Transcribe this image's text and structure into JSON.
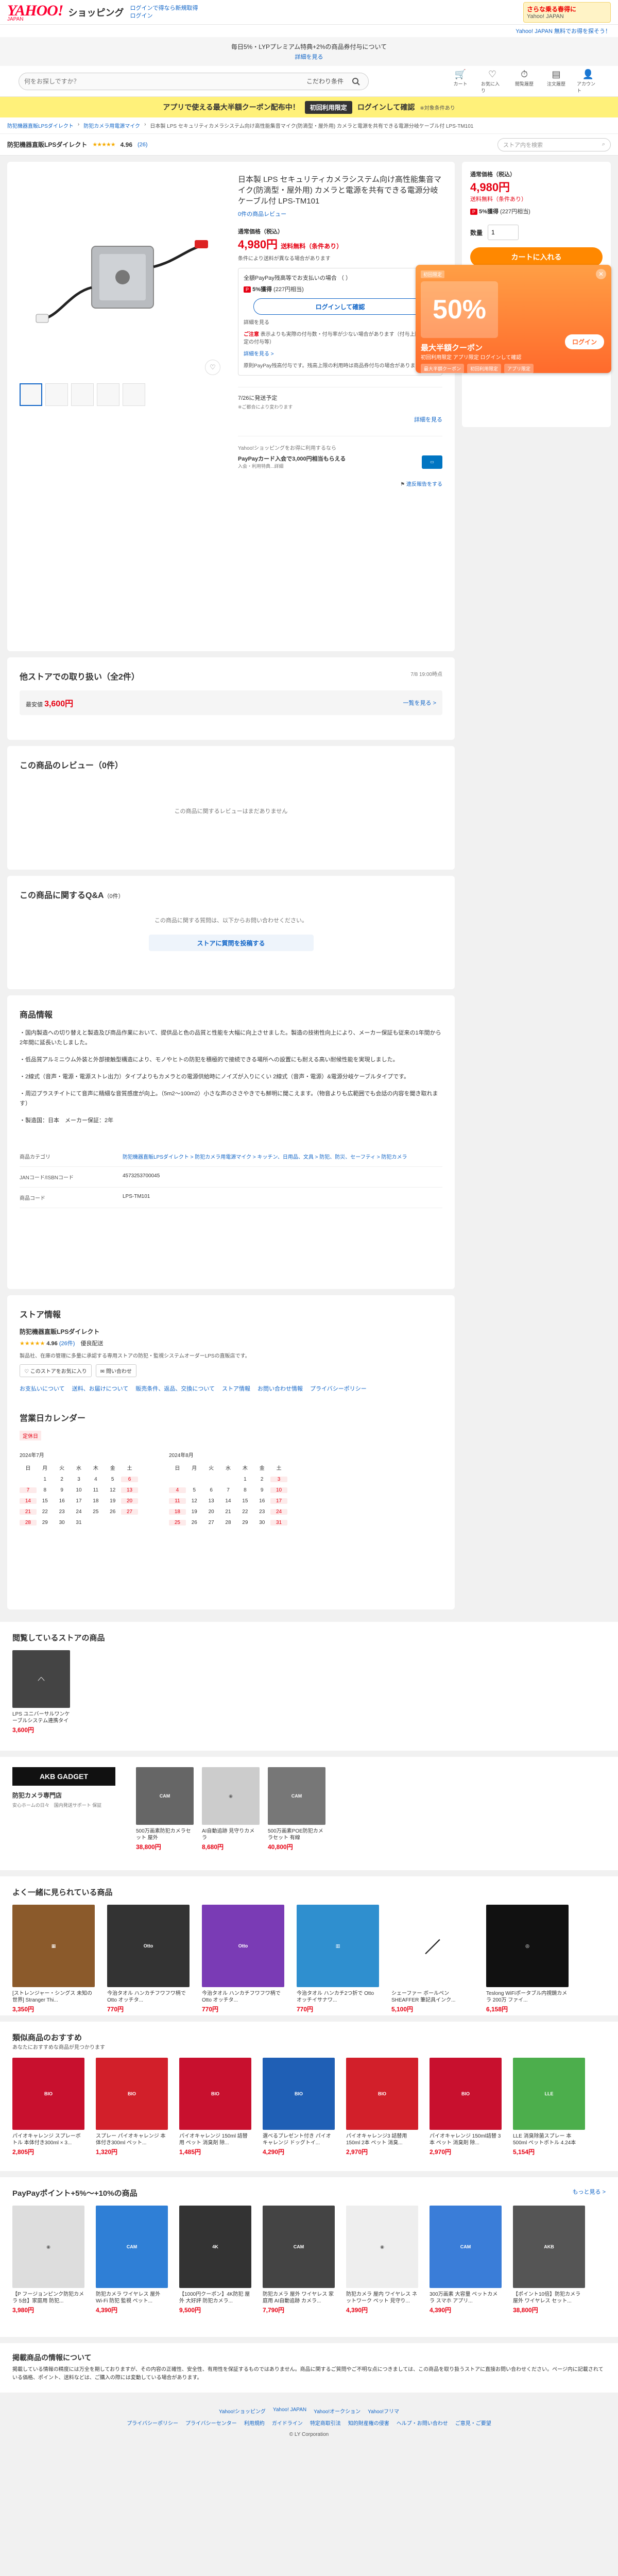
{
  "header": {
    "logo": "YAHOO!",
    "logo_sub": "JAPAN",
    "service": "ショッピング",
    "link_1": "ログインで得なら新規取得",
    "link_2": "ログイン",
    "banner_title": "さらな乗る春得に",
    "banner_sub": "Yahoo! JAPAN",
    "yj_link": "Yahoo! JAPAN 無料でお得を探そう！"
  },
  "notice": {
    "text": "毎日5%・LYPプレミアム特典+2%の商品券付与について",
    "link": "詳細を見る"
  },
  "search": {
    "placeholder": "何をお探しですか？",
    "cond": "こだわり条件",
    "icons": [
      {
        "label": "カート",
        "glyph": "🛒",
        "icon": "cart-icon"
      },
      {
        "label": "お気に入り",
        "glyph": "♡",
        "icon": "heart-icon"
      },
      {
        "label": "閲覧履歴",
        "glyph": "⏱",
        "icon": "history-icon"
      },
      {
        "label": "注文履歴",
        "glyph": "▤",
        "icon": "order-icon"
      },
      {
        "label": "アカウント",
        "glyph": "👤",
        "icon": "user-icon"
      }
    ]
  },
  "app_banner": {
    "text": "アプリで使える最大半額クーポン配布中！",
    "highlight": "初回利用限定",
    "cta": "ログインして確認",
    "small": "※対象条件あり"
  },
  "breadcrumb": [
    "防犯機器直販LPSダイレクト",
    "防犯カメラ用電源マイク",
    "日本製 LPS セキュリティカメラシステム向け高性能集音マイク(防滴型・屋外用) カメラと電源を共有できる電源分岐ケーブル付 LPS-TM101"
  ],
  "store_row": {
    "name": "防犯機器直販LPSダイレクト",
    "stars": "★★★★★",
    "rating": "4.96",
    "count": "(26)",
    "search_placeholder": "ストア内を検索"
  },
  "product": {
    "title": "日本製 LPS セキュリティカメラシステム向け高性能集音マイク(防滴型・屋外用) カメラと電源を共有できる電源分岐ケーブル付 LPS-TM101",
    "review_link": "0件の商品レビュー",
    "price_label": "通常価格（税込）",
    "price": "4,980円",
    "price_suffix": "送料無料（条件あり）",
    "ship_note": "条件により送料が異なる場合があります",
    "pay_line": "全額PayPay残高等でお支払いの場合 （ ）",
    "pp_rate": "5%獲得",
    "pp_points": "(227円相当)",
    "login_btn": "ログインして確認",
    "detail_1": "詳細を見る",
    "warning": "ご注意",
    "warning_text": "表示よりも実際の付与数・付与率が少ない場合があります（付与上限、未確定の付与等）",
    "detail_2": "詳細を見る >",
    "detail_3": "原則PayPay残高付与です。残高上限の利用時は商品券付与の場合があります。",
    "ship_sched": "7/26に発送予定",
    "ship_sched_sub": "※ご都合により変わります",
    "more": "詳細を見る",
    "ppcard_note": "Yahoo!ショッピングをお得に利用するなら",
    "ppcard_text": "PayPayカード入会で3,000円相当もらえる",
    "ppcard_sub": "入会・利用特典...詳細",
    "violate": "違反報告をする"
  },
  "thumbs": [
    "",
    "",
    "",
    "",
    ""
  ],
  "side": {
    "price_label": "通常価格（税込）",
    "price": "4,980円",
    "ship": "送料無料（条件あり）",
    "pp_rate": "5%獲得",
    "pp_points": "(227円相当)",
    "qty_label": "数量",
    "qty_value": "1",
    "cart": "カートに入れる"
  },
  "coupon": {
    "tag": "初回限定",
    "percent": "50%",
    "title": "最大半額クーポン",
    "sub": "初回利用限定 アプリ限定 ログインして確認",
    "login": "ログイン",
    "chips": [
      "最大半額クーポン",
      "初回利用限定",
      "アプリ限定"
    ]
  },
  "other_stores": {
    "title": "他ストアでの取り扱い（全2件）",
    "date": "7/8 19:00時点",
    "lowest_label": "最安値",
    "lowest_price": "3,600円",
    "list_link": "一覧を見る >"
  },
  "reviews": {
    "title": "この商品のレビュー（0件）",
    "empty": "この商品に関するレビューはまだありません"
  },
  "qa": {
    "title": "この商品に関するQ&A",
    "count": "（0件）",
    "empty": "この商品に関する質問は、以下からお問い合わせください。",
    "button": "ストアに質問を投稿する"
  },
  "product_info": {
    "title": "商品情報",
    "paragraphs": [
      "・国内製造への切り替えと製造及び商品作業において、提供品と色の品質と性能を大幅に向上させました。製造の技術性向上により、メーカー保証も従来の1年間から2年間に延長いたしました。",
      "・低品質アルミニウム外装と外部接触型構造により、モノやヒトの防犯を積極的で接続できる場所への設置にも耐える高い耐候性能を実現しました。",
      "・2線式（音声・電源・電源ストレ出力）タイプよりもカメラとの電源供給時にノイズが入りにくい 2線式（音声・電源）&電源分岐ケーブルタイプです。",
      "・周辺プラスチイトにて音声に精細な音質感度が向上。（5m2〜100m2）小さな声のささやきでも鮮明に聞こえます。（物音よりも広範囲でも会話の内容を聞き取れます）",
      "・製造国：日本　メーカー保証：2年"
    ],
    "specs": [
      {
        "k": "商品カテゴリ",
        "v": "防犯機器直販LPSダイレクト > 防犯カメラ用電源マイク > キッチン、日用品、文具 > 防犯、防災、セーフティ > 防犯カメラ"
      },
      {
        "k": "JANコード/ISBNコード",
        "v": "4573253700045"
      },
      {
        "k": "商品コード",
        "v": "LPS-TM101"
      }
    ]
  },
  "store_info": {
    "title": "ストア情報",
    "name": "防犯機器直販LPSダイレクト",
    "stars": "★★★★★",
    "rating": "4.96",
    "count": "(26件)",
    "badge": "優良配送",
    "note": "製品社、在庫の管理に多量に承認する専用ストアの防犯・監視システムオーダーLPSの直販店です。",
    "follow": "このストアをお気に入り",
    "contact": "問い合わせ",
    "links": [
      "お支払いについて",
      "送料、お届けについて",
      "販売条件、返品、交換について",
      "ストア情報",
      "お問い合わせ情報",
      "プライバシーポリシー"
    ]
  },
  "calendar": {
    "title": "営業日カレンダー",
    "legend": "定休日",
    "weekdays": [
      "日",
      "月",
      "火",
      "水",
      "木",
      "金",
      "土"
    ],
    "months": [
      {
        "label": "2024年7月",
        "days": [
          "",
          "1",
          "2",
          "3",
          "4",
          "5",
          "6",
          "7",
          "8",
          "9",
          "10",
          "11",
          "12",
          "13",
          "14",
          "15",
          "16",
          "17",
          "18",
          "19",
          "20",
          "21",
          "22",
          "23",
          "24",
          "25",
          "26",
          "27",
          "28",
          "29",
          "30",
          "31"
        ]
      },
      {
        "label": "2024年8月",
        "days": [
          "",
          "",
          "",
          "",
          "1",
          "2",
          "3",
          "4",
          "5",
          "6",
          "7",
          "8",
          "9",
          "10",
          "11",
          "12",
          "13",
          "14",
          "15",
          "16",
          "17",
          "18",
          "19",
          "20",
          "21",
          "22",
          "23",
          "24",
          "25",
          "26",
          "27",
          "28",
          "29",
          "30",
          "31"
        ]
      }
    ]
  },
  "related_store": {
    "title": "閲覧しているストアの商品",
    "items": [
      {
        "name": "LPS ユニバーサルワンケーブルシステム連携タイプ...",
        "price": "3,600円",
        "color": "#444"
      }
    ]
  },
  "ad_store": {
    "logo": "AKB GADGET",
    "name": "防犯カメラ専門店",
    "sub": "安心ホームの日々　国内発送サポート 保証",
    "items": [
      {
        "name": "500万画素防犯カメラセット 屋外",
        "price": "38,800円",
        "color": "#666"
      },
      {
        "name": "AI自動追跡 見守りカメラ",
        "price": "8,680円",
        "color": "#bbb"
      },
      {
        "name": "500万画素POE防犯カメラセット 有線",
        "price": "40,800円",
        "color": "#777"
      }
    ]
  },
  "viewed": {
    "title": "よく一緒に見られている商品",
    "items": [
      {
        "name": "[ストレンジャー・シングス 未知の世界] Stranger Thi...",
        "price": "3,350円",
        "color": "#8b5a2b"
      },
      {
        "name": "今治タオル ハンカチフワフワ柄で Otto オッチタ...",
        "price": "770円",
        "color": "#333"
      },
      {
        "name": "今治タオル ハンカチフワフワ柄で Otto オッチタ...",
        "price": "770円",
        "color": "#7a3bb5"
      },
      {
        "name": "今治タオル ハンカチ2つ折で Otto オッチイサナワ...",
        "price": "770円",
        "color": "#2f8fcf"
      },
      {
        "name": "シェーファー ボールペン SHEAFFER 筆記具インク...",
        "price": "5,100円",
        "color": "#222"
      },
      {
        "name": "Teslong WiFiポータブル内視鏡カメラ 200万 ファイ...",
        "price": "6,158円",
        "color": "#111"
      }
    ]
  },
  "similar": {
    "title": "類似商品のおすすめ",
    "sub": "あなたにおすすめな商品が見つかります",
    "items": [
      {
        "name": "パイオキャレンジ スプレーボトル 本体付き300ml × 3...",
        "price": "2,805円",
        "color": "#c8102e"
      },
      {
        "name": "スプレー パイオキャレンジ 本体付き300ml ペット...",
        "price": "1,320円",
        "color": "#d21f2a"
      },
      {
        "name": "パイオキャレンジ 150ml 詰替用 ペット 消臭剤 除...",
        "price": "1,485円",
        "color": "#c8102e"
      },
      {
        "name": "選べるプレゼント付き パイオキャレンジ ドッグトイ...",
        "price": "4,290円",
        "color": "#1f5fb5"
      },
      {
        "name": "パイオキャレンジ3 詰替用 150ml 2本 ペット 消臭...",
        "price": "2,970円",
        "color": "#d21f2a"
      },
      {
        "name": "パイオキャレンジ 150ml詰替 3本 ペット 消臭剤 除...",
        "price": "2,970円",
        "color": "#c8102e"
      },
      {
        "name": "LLE 消臭除菌スプレー 本 500ml ペットボトル 4.24本 (LE 消...",
        "price": "5,154円",
        "color": "#4cae4c"
      }
    ]
  },
  "paypay": {
    "title": "PayPayポイント+5%〜+10%の商品",
    "more": "もっと見る >",
    "items": [
      {
        "name": "【P フージョンピンク防犯カメラ 5台】家庭用 防犯...",
        "price": "3,980円",
        "color": "#ddd"
      },
      {
        "name": "防犯カメラ ワイヤレス 屋外 Wi-Fi 防犯 監視 ペット...",
        "price": "4,390円",
        "color": "#2f7fd6"
      },
      {
        "name": "【1000円クーポン】4K防犯 屋外 大好評 防犯カメラ...",
        "price": "9,500円",
        "color": "#333"
      },
      {
        "name": "防犯カメラ 屋外 ワイヤレス 家庭用 AI自動追跡 カメラ...",
        "price": "7,790円",
        "color": "#444"
      },
      {
        "name": "防犯カメラ 屋内 ワイヤレス ネットワーク ペット 見守り...",
        "price": "4,390円",
        "color": "#eee"
      },
      {
        "name": "300万画素 大容量 ペットカメラ スマホ アプリ...",
        "price": "4,390円",
        "color": "#3a7dd8"
      },
      {
        "name": "【ポイント10倍】防犯カメラ 屋外 ワイヤレス セット...",
        "price": "38,800円",
        "color": "#555"
      }
    ]
  },
  "footer_note": {
    "title": "掲載商品の情報について",
    "text": "掲載している情報の精度には万全を期しておりますが、その内容の正確性、安全性、有用性を保証するものではありません。商品に関するご質問やご不明な点につきましては、この商品を取り扱うストアに直接お問い合わせください。ページ内に記載されている価格、ポイント、送料などは、ご購入の際には変動している場合があります。"
  },
  "footer": {
    "links_1": [
      "Yahoo!ショッピング",
      "Yahoo! JAPAN",
      "Yahoo!オークション",
      "Yahoo!フリマ"
    ],
    "links_2": [
      "プライバシーポリシー",
      "プライバシーセンター",
      "利用規約",
      "ガイドライン",
      "特定商取引法",
      "知的財産権の侵害",
      "ヘルプ・お問い合わせ",
      "ご意見・ご要望"
    ],
    "copyright": "© LY Corporation"
  }
}
